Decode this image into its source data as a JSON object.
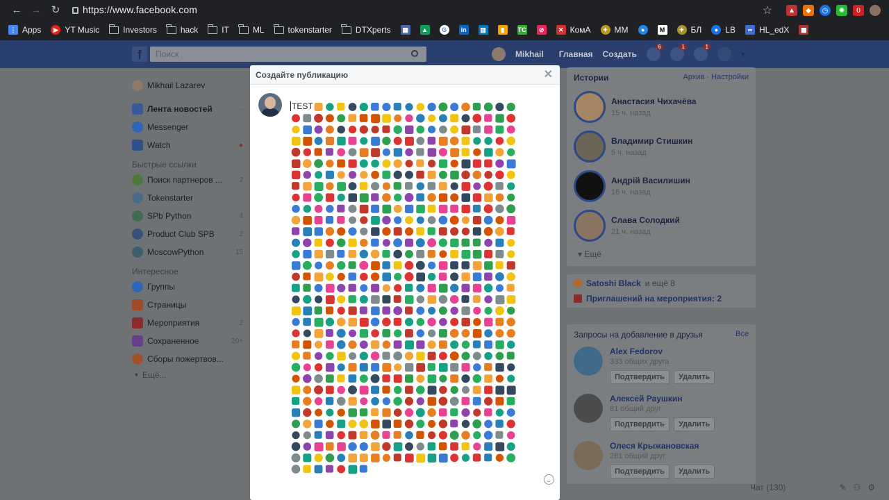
{
  "browser": {
    "url": "https://www.facebook.com",
    "bookmarks": [
      "Apps",
      "YT Music",
      "Investors",
      "hack",
      "IT",
      "ML",
      "tokenstarter",
      "DTXperts",
      "КомА",
      "ММ",
      "БЛ",
      "LB",
      "HL_edX"
    ]
  },
  "fb": {
    "search_placeholder": "Поиск",
    "profile_name": "Mikhail",
    "home_label": "Главная",
    "create_label": "Создать",
    "friends_badge": "6",
    "messages_badge": "1",
    "notif_badge": "1"
  },
  "left": {
    "user": "Mikhail Lazarev",
    "items": [
      {
        "label": "Лента новостей",
        "count": "···"
      },
      {
        "label": "Messenger",
        "count": ""
      },
      {
        "label": "Watch",
        "count": ""
      }
    ],
    "quick_title": "Быстрые ссылки",
    "quick": [
      {
        "label": "Поиск партнеров ...",
        "count": "2"
      },
      {
        "label": "Tokenstarter",
        "count": ""
      },
      {
        "label": "SPb Python",
        "count": "4"
      },
      {
        "label": "Product Club SPB",
        "count": "2"
      },
      {
        "label": "MoscowPython",
        "count": "15"
      }
    ],
    "interest_title": "Интересное",
    "interest": [
      {
        "label": "Группы",
        "count": ""
      },
      {
        "label": "Страницы",
        "count": ""
      },
      {
        "label": "Мероприятия",
        "count": "2"
      },
      {
        "label": "Сохраненное",
        "count": "20+"
      },
      {
        "label": "Сборы пожертвов...",
        "count": ""
      }
    ],
    "more": "Ещё..."
  },
  "modal": {
    "title": "Создайте публикацию",
    "text": "TEST"
  },
  "right": {
    "stories_title": "Истории",
    "stories_links": "Архив · Настройки",
    "stories": [
      {
        "name": "Анастасия Чихачёва",
        "time": "15 ч. назад"
      },
      {
        "name": "Владимир Стишкин",
        "time": "5 ч. назад"
      },
      {
        "name": "Андрій Василишин",
        "time": "16 ч. назад"
      },
      {
        "name": "Слава Солодкий",
        "time": "21 ч. назад"
      }
    ],
    "more": "Ещё",
    "bday_name": "Satoshi Black",
    "bday_rest": "и ещё 8",
    "events": "Приглашений на мероприятия: 2",
    "req_title": "Запросы на добавление в друзья",
    "req_all": "Все",
    "requests": [
      {
        "name": "Alex Fedorov",
        "mutual": "333 общих друга"
      },
      {
        "name": "Алексей Раушкин",
        "mutual": "81 общий друг"
      },
      {
        "name": "Олеся Крыжановская",
        "mutual": "281 общий друг"
      }
    ],
    "confirm": "Подтвердить",
    "delete": "Удалить"
  },
  "chat": {
    "label": "Чат (130)"
  },
  "colors": {
    "fb_blue": "#2a3f6d",
    "overlay": "#6f7275"
  }
}
